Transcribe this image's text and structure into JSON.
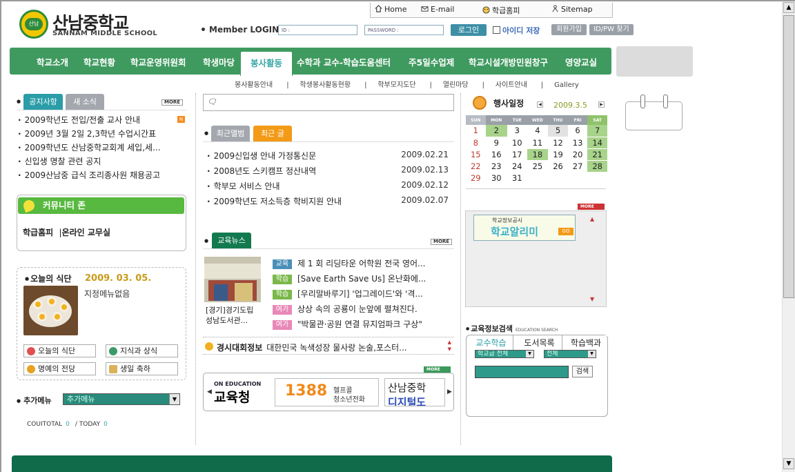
{
  "school": {
    "name_ko": "산남중학교",
    "name_en": "SANNAM MIDDLE SCHOOL",
    "emblem_text": "산남"
  },
  "topnav": [
    {
      "label": "Home",
      "icon": "home-icon"
    },
    {
      "label": "E-mail",
      "icon": "email-icon"
    },
    {
      "label": "학급홈피",
      "icon": "smiley-icon"
    },
    {
      "label": "Sitemap",
      "icon": "sitemap-icon"
    }
  ],
  "login": {
    "title": "Member LOGIN",
    "id_placeholder": "ID :",
    "pw_placeholder": "PASSWORD :",
    "login_button": "로그인",
    "save_id": "아이디 저장",
    "join_button": "회원가입",
    "find_button": "ID/PW 찾기"
  },
  "mainnav": [
    "학교소개",
    "학교현황",
    "학교운영위원회",
    "학생마당",
    "봉사활동",
    "수학과 교수-학습도움센터",
    "주5일수업제",
    "학교시설개방민원창구",
    "영양교실"
  ],
  "mainnav_active": "봉사활동",
  "subnav": [
    "봉사활동안내",
    "학생봉사활동현황",
    "학부모지도단",
    "열린마당",
    "사이트안내",
    "Gallery"
  ],
  "notice": {
    "tab_active": "공지사항",
    "tab_inactive": "새 소식",
    "more": "MORE",
    "new_badge": "N",
    "items": [
      "2009학년도 전입/전출 교사 안내",
      "2009년 3월 2일 2,3학년 수업시간표",
      "2009학년도 산남중학교회계 세입,세...",
      "신입생 명찰 관련 공지",
      "2009산남중 급식 조리종사원 채용공고"
    ]
  },
  "community": {
    "title": "커뮤니티 존",
    "link1": "학급홈피",
    "link2": "온라인 교무실"
  },
  "meal": {
    "title": "오늘의 식단",
    "date": "2009. 03. 05.",
    "text": "지정메뉴없음",
    "buttons": [
      "오늘의 식단",
      "지식과 상식",
      "명예의 전당",
      "생일 축하"
    ]
  },
  "addmenu": {
    "label": "추가메뉴",
    "selected": "추가메뉴"
  },
  "counter": {
    "total_label": "COUITOTAL",
    "total": "0",
    "today_label": "TODAY",
    "today": "0"
  },
  "recent": {
    "tab_inactive": "최근앨범",
    "tab_active": "최근 글",
    "items": [
      {
        "title": "2009신입생 안내 가정통신문",
        "date": "2009.02.21"
      },
      {
        "title": "2008년도 스키캠프 정산내역",
        "date": "2009.02.13"
      },
      {
        "title": "학부모 서비스 안내",
        "date": "2009.02.12"
      },
      {
        "title": "2009학년도 저소득층 학비지원 안내",
        "date": "2009.02.07"
      }
    ]
  },
  "edunews": {
    "tab": "교육뉴스",
    "more": "MORE",
    "caption1": "[경기]경기도립",
    "caption2": "성남도서관...",
    "items": [
      {
        "tag": "교육",
        "color": "#4a8fb8",
        "title": "제 1 회 리딩타운 어학원 전국 영어..."
      },
      {
        "tag": "학습",
        "color": "#7ab84a",
        "title": "[Save Earth Save Us] 온난화에..."
      },
      {
        "tag": "학습",
        "color": "#7ab84a",
        "title": "[우리말바루기] '업그레이드'와 '격..."
      },
      {
        "tag": "여가",
        "color": "#e888b8",
        "title": "상상 속의 공룡이 눈앞에 펼쳐진다."
      },
      {
        "tag": "여가",
        "color": "#e888b8",
        "title": "\"박물관·공원 연결 뮤지엄파크 구상\""
      }
    ]
  },
  "contest": {
    "label": "경시대회정보",
    "text": "대한민국 녹색성장 물사랑 논술,포스터..."
  },
  "banners": {
    "more": "MORE",
    "b1_top": "ON EDUCATION",
    "b1_main": "교육청",
    "b2_num": "1388",
    "b2_line1": "헬프콜",
    "b2_line2": "청소년전화",
    "b3_line1": "산남중학",
    "b3_line2": "디지털도"
  },
  "calendar": {
    "title": "행사일정",
    "month": "2009.3.5",
    "days": [
      "SUN",
      "MON",
      "TUE",
      "WED",
      "THU",
      "FRI",
      "SAT"
    ],
    "weeks": [
      [
        "1",
        "2",
        "3",
        "4",
        "5",
        "6",
        "7"
      ],
      [
        "8",
        "9",
        "10",
        "11",
        "12",
        "13",
        "14"
      ],
      [
        "15",
        "16",
        "17",
        "18",
        "19",
        "20",
        "21"
      ],
      [
        "22",
        "23",
        "24",
        "25",
        "26",
        "27",
        "28"
      ],
      [
        "29",
        "30",
        "31",
        "",
        "",
        "",
        ""
      ]
    ]
  },
  "notiboard": {
    "more": "MORE",
    "small": "학교정보공시",
    "big": "학교알리미",
    "go": "GO"
  },
  "edusearch": {
    "title": "교육정보검색",
    "subtitle": "EDUCATION SEARCH",
    "tabs": [
      "교수학습",
      "도서목록",
      "학습백과"
    ],
    "sel1": "학교급 전체",
    "sel2": "전체",
    "button": "검색"
  },
  "colors": {
    "nav_green": "#3f9a5f",
    "accent_teal": "#3aa8a6",
    "footer_green": "#0f6b4a"
  }
}
